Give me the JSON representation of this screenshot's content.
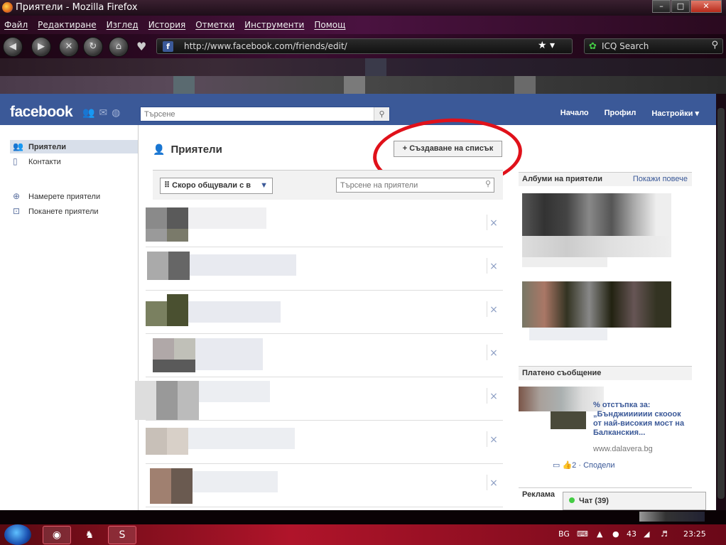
{
  "window": {
    "title": "Приятели - Mozilla Firefox",
    "min": "–",
    "max": "□",
    "close": "✕"
  },
  "menu": [
    "Файл",
    "Редактиране",
    "Изглед",
    "История",
    "Отметки",
    "Инструменти",
    "Помощ"
  ],
  "address": {
    "url": "http://www.facebook.com/friends/edit/"
  },
  "browser_search": {
    "label": "ICQ Search"
  },
  "fb": {
    "logo": "facebook",
    "search_placeholder": "Търсене",
    "top_links": [
      "Начало",
      "Профил",
      "Настройки ▾"
    ],
    "left_nav": [
      {
        "label": "Приятели",
        "icon": "friends-icon",
        "selected": true
      },
      {
        "label": "Контакти",
        "icon": "phone-icon",
        "selected": false
      },
      {
        "label": "Намерете приятели",
        "icon": "find-friends-icon",
        "selected": false
      },
      {
        "label": "Поканете приятели",
        "icon": "invite-icon",
        "selected": false
      }
    ],
    "page_title": "Приятели",
    "create_list": "+ Създаване на списък",
    "filter": {
      "selected": "Скоро общували с в",
      "search_placeholder": "Търсене на приятели"
    },
    "remove_glyph": "×",
    "right": {
      "albums_title": "Албуми на приятели",
      "albums_more": "Покажи повече",
      "sponsored_title": "Платено съобщение",
      "ad_title": "% отстъпка за: „Бънджииииии скооок от най-високия мост на Балканския...",
      "ad_domain": "www.dalavera.bg",
      "ad_likes": "2",
      "ad_share": "Сподели",
      "ads_title": "Реклама"
    },
    "chat": "Чат (39)"
  },
  "taskbar": {
    "lang": "BG",
    "time": "23:25",
    "tray_num": "43"
  }
}
